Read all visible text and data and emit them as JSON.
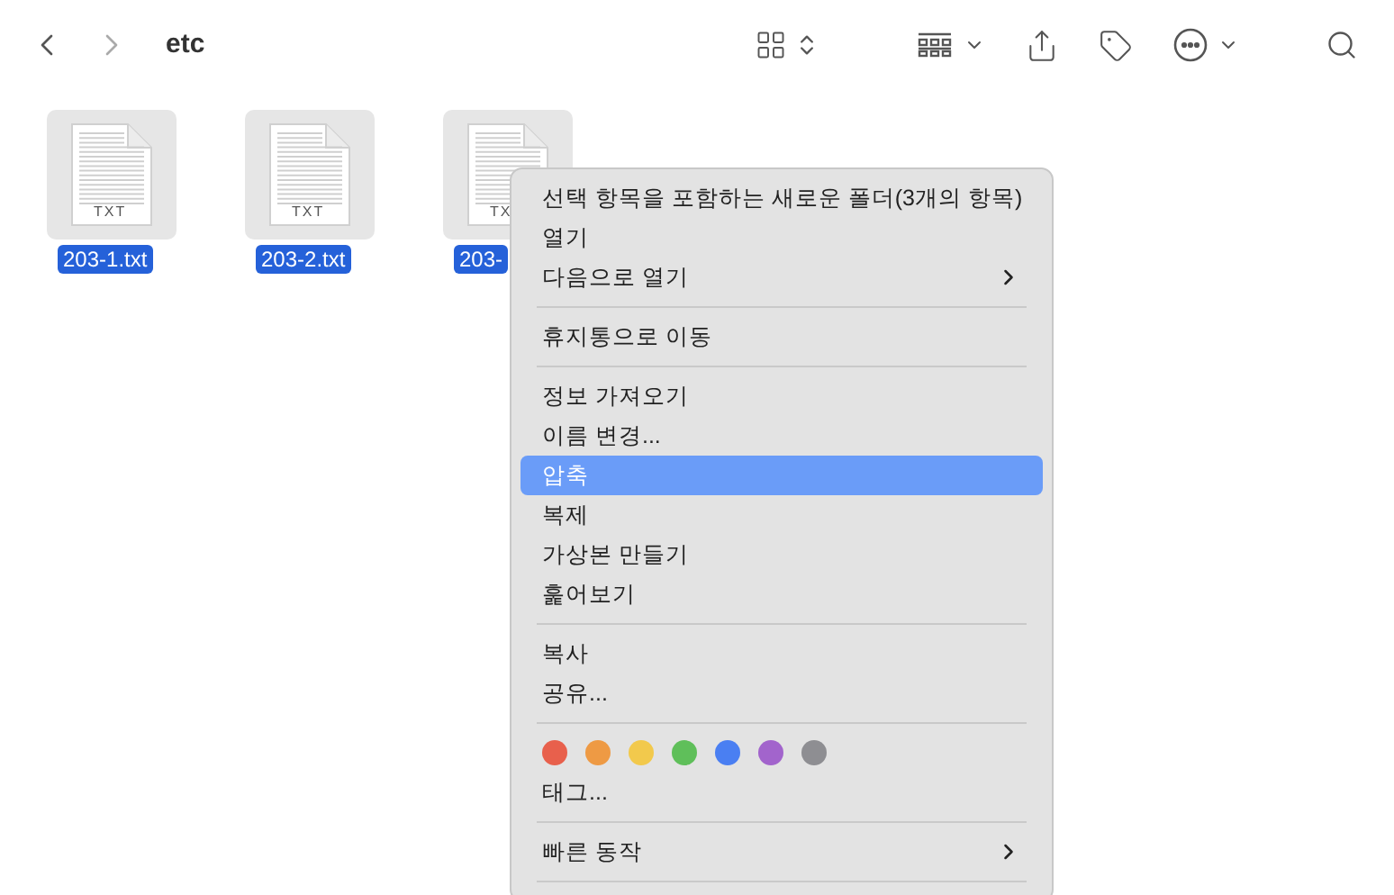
{
  "toolbar": {
    "title": "etc"
  },
  "files": [
    {
      "name": "203-1.txt",
      "badge": "TXT",
      "selected": true
    },
    {
      "name": "203-2.txt",
      "badge": "TXT",
      "selected": true
    },
    {
      "name": "203-",
      "badge": "TX",
      "selected": true
    }
  ],
  "context_menu": {
    "items": [
      {
        "kind": "item",
        "label": "선택 항목을 포함하는 새로운 폴더(3개의 항목)",
        "selected": false
      },
      {
        "kind": "item",
        "label": "열기",
        "selected": false
      },
      {
        "kind": "submenu",
        "label": "다음으로 열기",
        "selected": false
      },
      {
        "kind": "separator"
      },
      {
        "kind": "item",
        "label": "휴지통으로 이동",
        "selected": false
      },
      {
        "kind": "separator"
      },
      {
        "kind": "item",
        "label": "정보 가져오기",
        "selected": false
      },
      {
        "kind": "item",
        "label": "이름 변경...",
        "selected": false
      },
      {
        "kind": "item",
        "label": "압축",
        "selected": true
      },
      {
        "kind": "item",
        "label": "복제",
        "selected": false
      },
      {
        "kind": "item",
        "label": "가상본 만들기",
        "selected": false
      },
      {
        "kind": "item",
        "label": "훑어보기",
        "selected": false
      },
      {
        "kind": "separator"
      },
      {
        "kind": "item",
        "label": "복사",
        "selected": false
      },
      {
        "kind": "item",
        "label": "공유...",
        "selected": false
      },
      {
        "kind": "separator"
      },
      {
        "kind": "colors",
        "colors": [
          {
            "color": "#e8604c"
          },
          {
            "color": "#ee9a44"
          },
          {
            "color": "#f2c94c"
          },
          {
            "color": "#5fbf5a"
          },
          {
            "color": "#4a7ff2"
          },
          {
            "color": "#a264cc"
          },
          {
            "color": "#8e8e92"
          }
        ]
      },
      {
        "kind": "item",
        "label": "태그...",
        "selected": false
      },
      {
        "kind": "separator"
      },
      {
        "kind": "submenu",
        "label": "빠른 동작",
        "selected": false
      },
      {
        "kind": "separator"
      }
    ]
  }
}
